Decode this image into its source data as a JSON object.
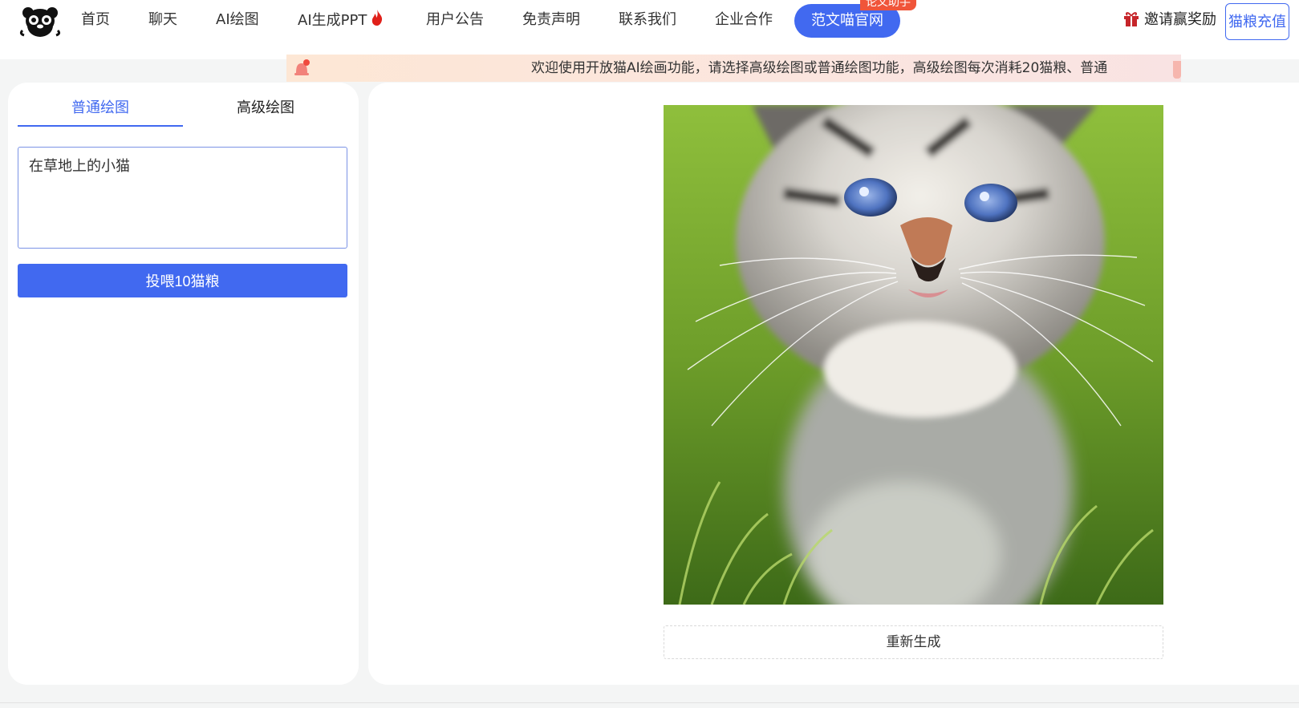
{
  "nav": {
    "logo": "panda-cat-logo",
    "items": [
      "首页",
      "聊天",
      "AI绘图",
      "AI生成PPT",
      "用户公告",
      "免责声明",
      "联系我们",
      "企业合作"
    ],
    "fire_icon": "fire-icon",
    "pill_label": "范文喵官网",
    "pill_badge": "论文助手",
    "invite_label": "邀请赢奖励",
    "gift_icon": "gift-icon",
    "recharge_label": "猫粮充值",
    "accent": "#4169f0",
    "badge_color": "#f0553a"
  },
  "notice": {
    "icon": "bell-icon",
    "text": "欢迎使用开放猫AI绘画功能，请选择高级绘图或普通绘图功能，高级绘图每次消耗20猫粮、普通"
  },
  "draw": {
    "tabs": [
      {
        "label": "普通绘图",
        "active": true
      },
      {
        "label": "高级绘图",
        "active": false
      }
    ],
    "prompt_value": "在草地上的小猫",
    "submit_label": "投喂10猫粮"
  },
  "result": {
    "image": "kitten-in-grass-image",
    "regenerate_label": "重新生成"
  }
}
